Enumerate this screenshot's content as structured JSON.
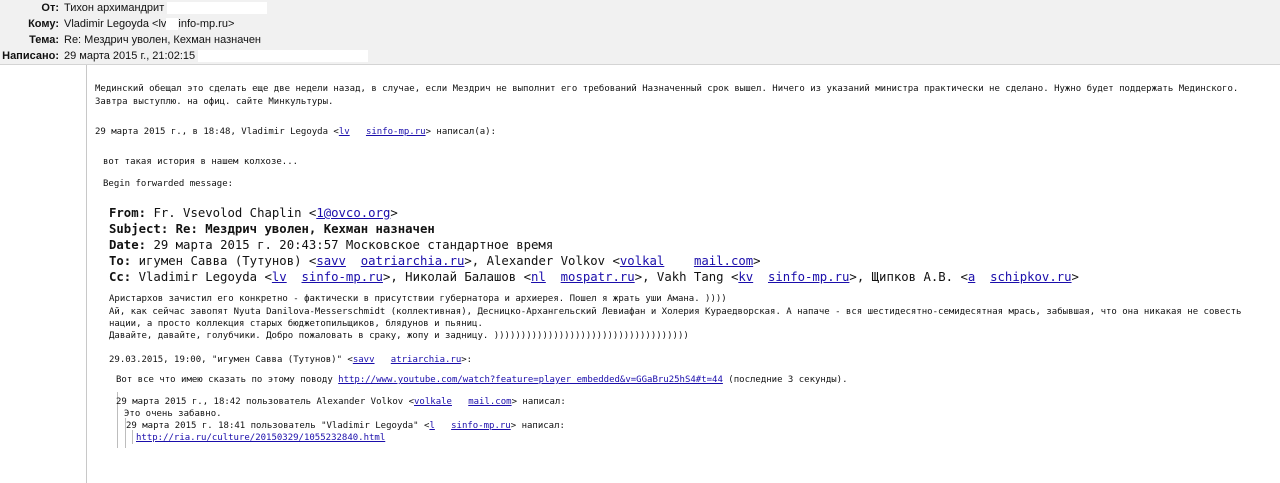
{
  "header": {
    "from_label": "От:",
    "from_value": "Тихон архимандрит",
    "to_label": "Кому:",
    "to_name": "Vladimir Legoyda <lv",
    "to_domain": "info-mp.ru>",
    "subject_label": "Тема:",
    "subject_value": "Re: Мездрич уволен, Кехман назначен",
    "date_label": "Написано:",
    "date_value": "29 марта 2015 г., 21:02:15"
  },
  "reply": {
    "line1": "Мединский обещал это сделать еще две недели назад, в случае, если Мездрич не выполнит его требований Назначенный срок вышел. Ничего из указаний министра практически не сделано. Нужно будет поддержать Мединского.",
    "line2": "Завтра выступлю. на офиц. сайте Минкультуры.",
    "attribution_pre": "29 марта 2015 г., в 18:48,  Vladimir Legoyda <",
    "attribution_link1": "lv",
    "attribution_link2": "sinfo-mp.ru",
    "attribution_post": "> написал(а):"
  },
  "quoted": {
    "line1": "вот такая история в нашем колхозе...",
    "line2": "Begin forwarded message:"
  },
  "forwarded": {
    "from_label": "From:",
    "from_pre": "Fr. Vsevolod Chaplin <",
    "from_link": "1@ovco.org",
    "from_post": ">",
    "subject_label": "Subject:",
    "subject_value": "Re: Мездрич уволен, Кехман назначен",
    "date_label": "Date:",
    "date_value": "29 марта 2015 г. 20:43:57 Московское стандартное время",
    "to_label": "To:",
    "to_pre": "игумен Савва (Тутунов) <",
    "to_link1": "savv",
    "to_link2": "oatriarchia.ru",
    "to_mid": ">, Alexander Volkov <",
    "to_link3": "volkal",
    "to_link4": "mail.com",
    "to_post": ">",
    "cc_label": "Cc:",
    "cc_pre": "Vladimir Legoyda <",
    "cc_link1": "lv",
    "cc_link2": "sinfo-mp.ru",
    "cc_mid1": ">, Николай Балашов <",
    "cc_link3": "nl",
    "cc_link4": "mospatr.ru",
    "cc_mid2": ">, Vakh Tang <",
    "cc_link5": "kv",
    "cc_link6": "sinfo-mp.ru",
    "cc_mid3": ">, Щипков А.В. <",
    "cc_link7": "a",
    "cc_link8": "schipkov.ru",
    "cc_post": ">"
  },
  "body": {
    "p1": "Аристархов зачистил его конкретно - фактически в присутствии губернатора и архиерея. Пошел я жрать уши Амана. ))))",
    "p2": "Ай, как сейчас завопят Nyuta Danilova-Messerschmidt (коллективная), Десницко-Архангельский Левиафан и Холерия Кураедворская. А напаче - вся шестидесятно-семидесятная мрась, забывшая, что она никакая не совесть",
    "p3": "нации, а просто коллекция старых бюджетопильщиков, блядунов и пьяниц.",
    "p4": "Давайте, давайте, голубчики. Добро пожаловать в сраку, жопу и задницу. ))))))))))))))))))))))))))))))))))))"
  },
  "savva": {
    "attr_pre": "29.03.2015, 19:00, \"игумен Савва (Тутунов)\" <",
    "attr_link1": "savv",
    "attr_link2": "atriarchia.ru",
    "attr_post": ">:",
    "text_pre": "Вот все что имею сказать по этому поводу ",
    "text_link": "http://www.youtube.com/watch?feature=player  embedded&v=GGaBru25hS4#t=44",
    "text_post": " (последние 3 секунды)."
  },
  "volkov": {
    "attr_pre": "29 марта 2015 г., 18:42 пользователь Alexander Volkov <",
    "attr_link1": "volkale",
    "attr_link2": "mail.com",
    "attr_post": "> написал:",
    "text": "Это очень забавно."
  },
  "legoyda": {
    "attr_pre": "29 марта 2015 г. 18:41 пользователь \"Vladimir Legoyda\" <",
    "attr_link1": "l",
    "attr_link2": "sinfo-mp.ru",
    "attr_post": "> написал:",
    "link": "http://ria.ru/culture/20150329/1055232840.html"
  }
}
